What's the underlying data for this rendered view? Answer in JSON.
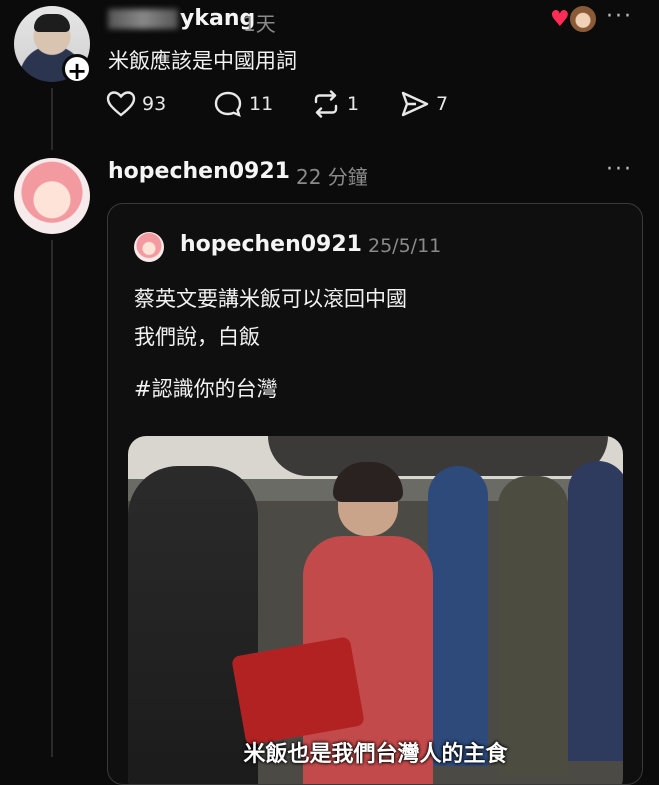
{
  "post1": {
    "username": "ykang",
    "time": "1天",
    "text": "米飯應該是中國用詞",
    "more": "···",
    "actions": {
      "likes": "93",
      "comments": "11",
      "reposts": "1",
      "shares": "7"
    }
  },
  "post2": {
    "username": "hopechen0921",
    "time": "22 分鐘",
    "more": "···",
    "quote": {
      "username": "hopechen0921",
      "time": "25/5/11",
      "line1": "蔡英文要講米飯可以滾回中國",
      "line2": "我們說，白飯",
      "hashtag": "#認識你的台灣",
      "caption": "米飯也是我們台灣人的主食"
    }
  },
  "icons": {
    "like": "heart-icon",
    "comment": "comment-bubble-icon",
    "repost": "repost-icon",
    "share": "send-icon",
    "follow": "plus-icon"
  },
  "colors": {
    "background": "#0b0b0b",
    "heart": "#ff2d55",
    "muted": "#8a8a8a"
  }
}
